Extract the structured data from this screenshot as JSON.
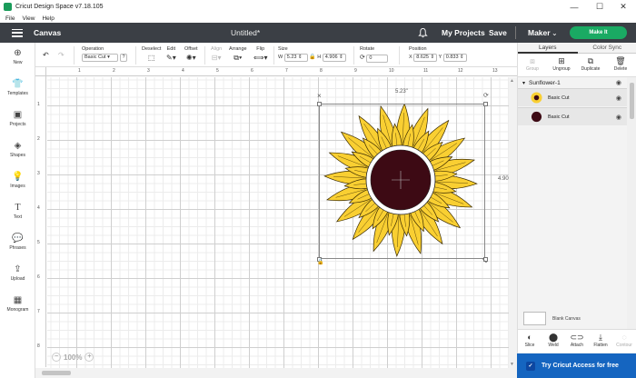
{
  "window": {
    "title": "Cricut Design Space  v7.18.105",
    "controls": {
      "minimize": "—",
      "maximize": "☐",
      "close": "✕"
    }
  },
  "menu": {
    "items": [
      "File",
      "View",
      "Help"
    ]
  },
  "header": {
    "canvas_label": "Canvas",
    "doc_title": "Untitled*",
    "my_projects": "My Projects",
    "save": "Save",
    "machine": "Maker",
    "make_it": "Make It"
  },
  "toolbar": {
    "operation_label": "Operation",
    "operation_value": "Basic Cut",
    "deselect_label": "Deselect",
    "edit_label": "Edit",
    "offset_label": "Offset",
    "align_label": "Align",
    "arrange_label": "Arrange",
    "flip_label": "Flip",
    "size_label": "Size",
    "size_w_label": "W",
    "size_w": "5.23",
    "size_h_label": "H",
    "size_h": "4.906",
    "rotate_label": "Rotate",
    "rotate_value": "0",
    "position_label": "Position",
    "pos_x_label": "X",
    "pos_x": "8.625",
    "pos_y_label": "Y",
    "pos_y": "0.833",
    "help": "?"
  },
  "rulers": {
    "top": [
      "1",
      "2",
      "3",
      "4",
      "5",
      "6",
      "7",
      "8",
      "9",
      "10",
      "11",
      "12",
      "13"
    ],
    "left": [
      "1",
      "2",
      "3",
      "4",
      "5",
      "6",
      "7",
      "8"
    ]
  },
  "canvas": {
    "width_label": "5.23\"",
    "height_label": "4.90",
    "zoom": "100%",
    "petal_color": "#f9cf32",
    "center_color": "#3d0a14"
  },
  "left_sidebar": {
    "items": [
      "New",
      "Templates",
      "Projects",
      "Shapes",
      "Images",
      "Text",
      "Phrases",
      "Upload",
      "Monogram"
    ]
  },
  "panel": {
    "tabs": [
      "Layers",
      "Color Sync"
    ],
    "top_actions": [
      "Group",
      "Ungroup",
      "Duplicate",
      "Delete"
    ],
    "group_name": "Sunflower-1",
    "layers": [
      {
        "name": "Basic Cut",
        "color": "#f9cf32"
      },
      {
        "name": "Basic Cut",
        "color": "#3d0a14"
      }
    ],
    "blank_canvas": "Blank Canvas",
    "bottom_actions": [
      "Slice",
      "Weld",
      "Attach",
      "Flatten",
      "Contour"
    ],
    "access_banner": "Try Cricut Access for free"
  }
}
